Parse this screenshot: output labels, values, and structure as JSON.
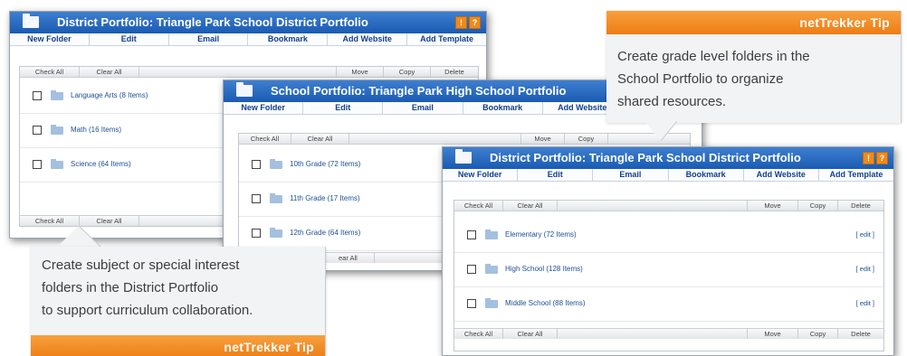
{
  "windows": {
    "w1": {
      "title": "District Portfolio: Triangle Park School District Portfolio",
      "help_icons": [
        "!",
        "?"
      ],
      "menu": [
        "New Folder",
        "Edit",
        "Email",
        "Bookmark",
        "Add Website",
        "Add Template"
      ],
      "toolbar": {
        "check_all": "Check All",
        "clear_all": "Clear All",
        "move": "Move",
        "copy": "Copy",
        "delete": "Delete"
      },
      "rows": [
        {
          "label": "Language Arts (8 Items)"
        },
        {
          "label": "Math (16 Items)"
        },
        {
          "label": "Science (64 Items)"
        }
      ]
    },
    "w2": {
      "title": "School Portfolio: Triangle Park High School Portfolio",
      "menu": [
        "New Folder",
        "Edit",
        "Email",
        "Bookmark",
        "Add Website"
      ],
      "toolbar": {
        "check_all": "Check All",
        "clear_all": "Clear All",
        "move": "Move",
        "copy": "Copy",
        "clear_all_partial": "ear All"
      },
      "rows": [
        {
          "label": "10th Grade (72 Items)"
        },
        {
          "label": "11th Grade (17 Items)"
        },
        {
          "label": "12th Grade (64 Items)"
        }
      ]
    },
    "w3": {
      "title": "District Portfolio: Triangle Park School District Portfolio",
      "help_icons": [
        "!",
        "?"
      ],
      "menu": [
        "New Folder",
        "Edit",
        "Email",
        "Bookmark",
        "Add Website",
        "Add Template"
      ],
      "toolbar": {
        "check_all": "Check All",
        "clear_all": "Clear All",
        "move": "Move",
        "copy": "Copy",
        "delete": "Delete"
      },
      "rows": [
        {
          "label": "Elementary (72 Items)",
          "edit": "[ edit ]"
        },
        {
          "label": "High School (128 Items)",
          "edit": "[ edit ]"
        },
        {
          "label": "Middle School (88 Items)",
          "edit": "[ edit ]"
        }
      ]
    }
  },
  "tips": {
    "top": {
      "header": "netTrekker Tip",
      "lines": [
        "Create grade level folders in the",
        "School Portfolio to organize",
        "shared resources."
      ]
    },
    "bottom": {
      "header": "netTrekker Tip",
      "lines": [
        "Create subject or special interest",
        "folders in the District Portfolio",
        "to support curriculum collaboration."
      ]
    }
  },
  "colors": {
    "titlebar": "#2a6bc1",
    "tip_header": "#f08a22",
    "link": "#1d4f93"
  }
}
